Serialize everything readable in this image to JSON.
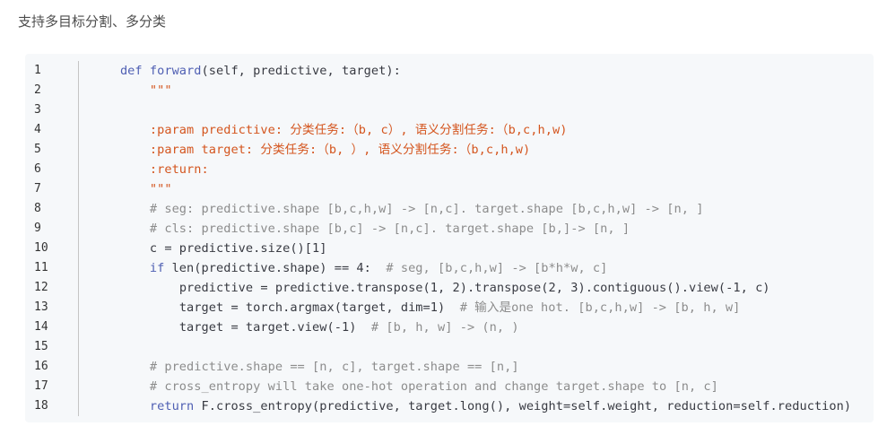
{
  "intro_text": "支持多目标分割、多分类",
  "code": {
    "line_numbers": [
      "1",
      "2",
      "3",
      "4",
      "5",
      "6",
      "7",
      "8",
      "9",
      "10",
      "11",
      "12",
      "13",
      "14",
      "15",
      "16",
      "17",
      "18"
    ],
    "lines": [
      {
        "indent": "    ",
        "kw": "def ",
        "fn": "forward",
        "rest": "(self, predictive, target):"
      },
      {
        "indent": "        ",
        "doc": "\"\"\""
      },
      {
        "indent": "",
        "doc": ""
      },
      {
        "indent": "        ",
        "doc": ":param predictive: 分类任务:（b, c）, 语义分割任务:（b,c,h,w)"
      },
      {
        "indent": "        ",
        "doc": ":param target: 分类任务:（b, ）, 语义分割任务:（b,c,h,w)"
      },
      {
        "indent": "        ",
        "doc": ":return:"
      },
      {
        "indent": "        ",
        "doc": "\"\"\""
      },
      {
        "indent": "        ",
        "comment": "# seg: predictive.shape [b,c,h,w] -> [n,c]. target.shape [b,c,h,w] -> [n, ]"
      },
      {
        "indent": "        ",
        "comment": "# cls: predictive.shape [b,c] -> [n,c]. target.shape [b,]-> [n, ]"
      },
      {
        "indent": "        ",
        "text": "c = predictive.size()[1]"
      },
      {
        "indent": "        ",
        "kw": "if ",
        "text": "len(predictive.shape) == 4:  ",
        "comment": "# seg, [b,c,h,w] -> [b*h*w, c]"
      },
      {
        "indent": "            ",
        "text": "predictive = predictive.transpose(1, 2).transpose(2, 3).contiguous().view(-1, c)"
      },
      {
        "indent": "            ",
        "text": "target = torch.argmax(target, dim=1)  ",
        "comment": "# 输入是one hot. [b,c,h,w] -> [b, h, w]"
      },
      {
        "indent": "            ",
        "text": "target = target.view(-1)  ",
        "comment": "# [b, h, w] -> (n, )"
      },
      {
        "indent": ""
      },
      {
        "indent": "        ",
        "comment": "# predictive.shape == [n, c], target.shape == [n,]"
      },
      {
        "indent": "        ",
        "comment": "# cross_entropy will take one-hot operation and change target.shape to [n, c]"
      },
      {
        "indent": "        ",
        "kw": "return ",
        "text": "F.cross_entropy(predictive, target.long(), weight=self.weight, reduction=self.reduction)"
      }
    ]
  }
}
